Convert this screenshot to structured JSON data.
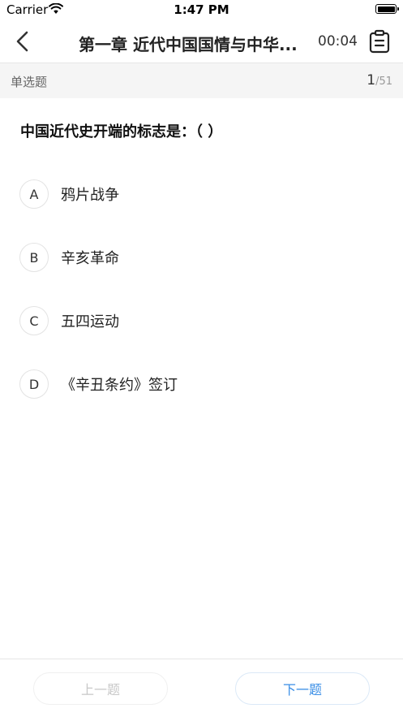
{
  "status_bar": {
    "carrier": "Carrier",
    "time": "1:47 PM"
  },
  "nav": {
    "title": "第一章 近代中国国情与中华...",
    "timer": "00:04",
    "back_icon": "chevron-left-icon",
    "answer_card_icon": "clipboard-icon"
  },
  "question_info": {
    "type": "单选题",
    "current": "1",
    "total": "/51"
  },
  "question": {
    "text": "中国近代史开端的标志是：（ ）",
    "options": [
      {
        "letter": "A",
        "text": "鸦片战争"
      },
      {
        "letter": "B",
        "text": "辛亥革命"
      },
      {
        "letter": "C",
        "text": "五四运动"
      },
      {
        "letter": "D",
        "text": "《辛丑条约》签订"
      }
    ]
  },
  "footer": {
    "prev_label": "上一题",
    "next_label": "下一题"
  },
  "colors": {
    "accent": "#3a8ee6",
    "disabled": "#c8c8c8",
    "type_bar_bg": "#f5f5f5"
  }
}
